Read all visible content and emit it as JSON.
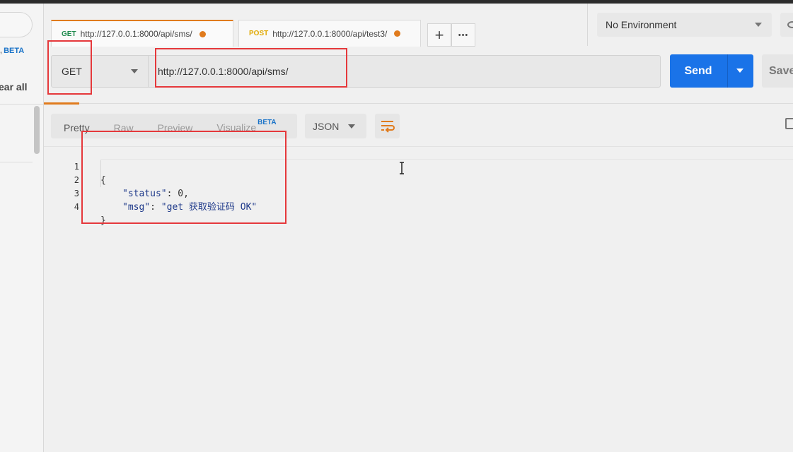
{
  "sidebar": {
    "beta_label": "BETA",
    "clear_all_label": "ear all",
    "item_glyph": "/"
  },
  "tabs": [
    {
      "method": "GET",
      "url": "http://127.0.0.1:8000/api/sms/",
      "active": true
    },
    {
      "method": "POST",
      "url": "http://127.0.0.1:8000/api/test3/",
      "active": false
    }
  ],
  "tab_actions": {
    "add": "+",
    "more": "•••"
  },
  "environment": {
    "selected": "No Environment"
  },
  "request": {
    "method": "GET",
    "url": "http://127.0.0.1:8000/api/sms/",
    "send_label": "Send",
    "save_label": "Save"
  },
  "response": {
    "view_tabs": [
      "Pretty",
      "Raw",
      "Preview",
      "Visualize"
    ],
    "visualize_badge": "BETA",
    "format": "JSON",
    "lines": [
      {
        "n": "1",
        "text": "{"
      },
      {
        "n": "2",
        "key": "\"status\"",
        "sep": ": ",
        "value": "0",
        "tail": ","
      },
      {
        "n": "3",
        "key": "\"msg\"",
        "sep": ": ",
        "value": "\"get 获取验证码 OK\"",
        "tail": ""
      },
      {
        "n": "4",
        "text": "}"
      }
    ]
  },
  "colors": {
    "accent": "#e07b1d",
    "send_blue": "#1a73e8",
    "annotation_red": "#e5383b",
    "get_green": "#1d8a4c",
    "post_yellow": "#e0a800"
  }
}
